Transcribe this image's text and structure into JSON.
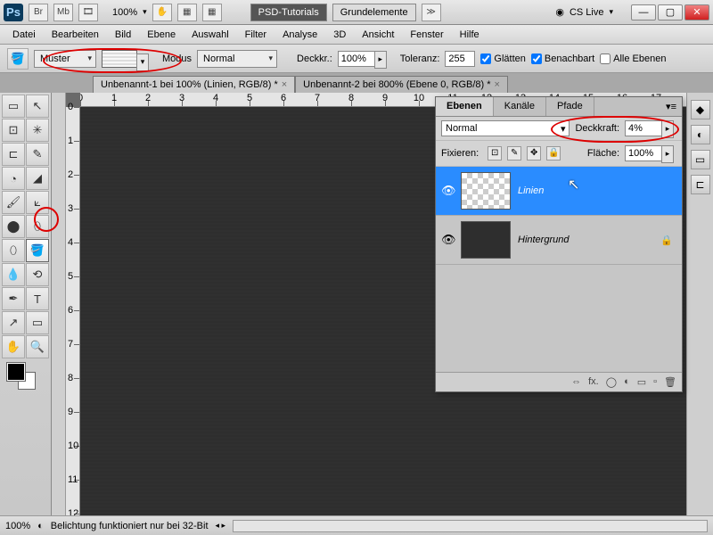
{
  "titlebar": {
    "br": "Br",
    "mb": "Mb",
    "film": "🎞",
    "zoom": "100%",
    "hand": "✋",
    "layout": "▦",
    "tab1": "PSD-Tutorials",
    "tab2": "Grundelemente",
    "expand": "≫",
    "cslive": "CS Live",
    "live_icon": "◉",
    "min": "—",
    "max": "▢",
    "close": "✕"
  },
  "menu": {
    "datei": "Datei",
    "bearbeiten": "Bearbeiten",
    "bild": "Bild",
    "ebene": "Ebene",
    "auswahl": "Auswahl",
    "filter": "Filter",
    "analyse": "Analyse",
    "d3": "3D",
    "ansicht": "Ansicht",
    "fenster": "Fenster",
    "hilfe": "Hilfe"
  },
  "optbar": {
    "muster": "Muster",
    "modus": "Modus",
    "normal": "Normal",
    "deckkr": "Deckkr.:",
    "deckkr_val": "100%",
    "toleranz": "Toleranz:",
    "toleranz_val": "255",
    "glatten": "Glätten",
    "benachbart": "Benachbart",
    "alle": "Alle Ebenen"
  },
  "doctabs": {
    "tab1": "Unbenannt-1 bei 100% (Linien, RGB/8) *",
    "tab2": "Unbenannt-2 bei 800% (Ebene 0, RGB/8) *"
  },
  "ruler": {
    "top": [
      "0",
      "1",
      "2",
      "3",
      "4",
      "5",
      "6",
      "7",
      "8",
      "9",
      "10",
      "11",
      "12",
      "13",
      "14",
      "15",
      "16",
      "17"
    ],
    "left": [
      "0",
      "1",
      "2",
      "3",
      "4",
      "5",
      "6",
      "7",
      "8",
      "9",
      "10",
      "11",
      "12"
    ]
  },
  "panel": {
    "tab_ebenen": "Ebenen",
    "tab_kanale": "Kanäle",
    "tab_pfade": "Pfade",
    "mode": "Normal",
    "deckkraft": "Deckkraft:",
    "deckkraft_val": "4%",
    "fixieren": "Fixieren:",
    "flache": "Fläche:",
    "flache_val": "100%",
    "layer1": "Linien",
    "layer2": "Hintergrund",
    "foot": {
      "link": "⇔",
      "fx": "fx.",
      "mask": "◯",
      "adj": "◐",
      "folder": "▭",
      "new": "▫",
      "trash": "🗑"
    }
  },
  "status": {
    "zoom": "100%",
    "msg": "Belichtung funktioniert nur bei 32-Bit"
  },
  "tools": [
    "▭",
    "↖",
    "⊡",
    "✳",
    "⊏",
    "✎",
    "◔",
    "◢",
    "🖌",
    "⟀",
    "⬤",
    "⬯",
    "⬯",
    "🪣",
    "💧",
    "⟲",
    "✒",
    "T",
    "↗",
    "▭",
    "✋",
    "🔍"
  ]
}
